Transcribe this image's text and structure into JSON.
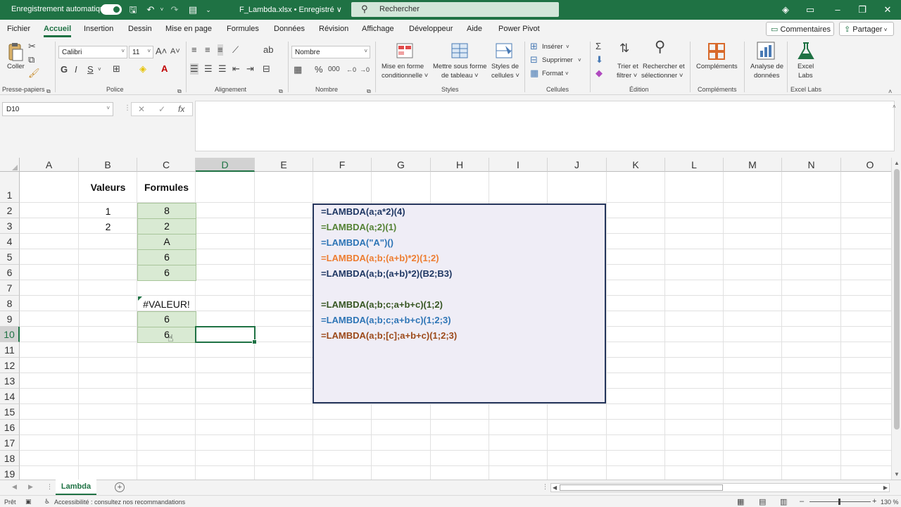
{
  "titlebar": {
    "autosave_label": "Enregistrement automatique",
    "file_title": "F_Lambda.xlsx • Enregistré ∨",
    "search_placeholder": "Rechercher",
    "accent_color": "#1f7244"
  },
  "menu": {
    "tabs": [
      "Fichier",
      "Accueil",
      "Insertion",
      "Dessin",
      "Mise en page",
      "Formules",
      "Données",
      "Révision",
      "Affichage",
      "Développeur",
      "Aide",
      "Power Pivot"
    ],
    "active_tab": "Accueil",
    "comments_label": "Commentaires",
    "share_label": "Partager"
  },
  "ribbon": {
    "clipboard": {
      "paste_label": "Coller",
      "group_label": "Presse-papiers"
    },
    "font": {
      "font_name": "Calibri",
      "font_size": "11",
      "bold": "G",
      "italic": "I",
      "underline": "S",
      "group_label": "Police"
    },
    "alignment": {
      "group_label": "Alignement"
    },
    "number": {
      "format": "Nombre",
      "group_label": "Nombre"
    },
    "styles": {
      "conditional_line1": "Mise en forme",
      "conditional_line2": "conditionnelle ˅",
      "table_line1": "Mettre sous forme",
      "table_line2": "de tableau ˅",
      "cellstyles_line1": "Styles de",
      "cellstyles_line2": "cellules ˅",
      "group_label": "Styles"
    },
    "cells": {
      "insert": "Insérer",
      "delete": "Supprimer",
      "format": "Format",
      "group_label": "Cellules"
    },
    "editing": {
      "sort_line1": "Trier et",
      "sort_line2": "filtrer ˅",
      "find_line1": "Rechercher et",
      "find_line2": "sélectionner ˅",
      "group_label": "Édition"
    },
    "addins": {
      "label": "Compléments",
      "group_label": "Compléments"
    },
    "analysis": {
      "line1": "Analyse de",
      "line2": "données"
    },
    "labs": {
      "line1": "Excel",
      "line2": "Labs",
      "group_label": "Excel Labs"
    }
  },
  "formula_bar": {
    "name_box": "D10",
    "cancel": "✕",
    "enter": "✓",
    "fx": "fx",
    "content": ""
  },
  "grid": {
    "columns": [
      "A",
      "B",
      "C",
      "D",
      "E",
      "F",
      "G",
      "H",
      "I",
      "J",
      "K",
      "L",
      "M",
      "N",
      "O"
    ],
    "selected_column": "D",
    "rows": [
      "1",
      "2",
      "3",
      "4",
      "5",
      "6",
      "7",
      "8",
      "9",
      "10",
      "11",
      "12",
      "13",
      "14",
      "15",
      "16",
      "17",
      "18",
      "19"
    ],
    "selected_row": "10",
    "headers": {
      "valeurs": "Valeurs",
      "formules": "Formules"
    },
    "valeurs": [
      "1",
      "2"
    ],
    "formules_top": [
      "8",
      "2",
      "A",
      "6",
      "6"
    ],
    "error_value": "#VALEUR!",
    "formules_bottom": [
      "6",
      "6"
    ]
  },
  "lambda_box": {
    "border_color": "#25365c",
    "lines": [
      {
        "text": "=LAMBDA(a;a*2)(4)",
        "color": "#203864"
      },
      {
        "text": "=LAMBDA(a;2)(1)",
        "color": "#548235"
      },
      {
        "text": "=LAMBDA(\"A\")()",
        "color": "#2e75b6"
      },
      {
        "text": "=LAMBDA(a;b;(a+b)*2)(1;2)",
        "color": "#ed7d31"
      },
      {
        "text": "=LAMBDA(a;b;(a+b)*2)(B2;B3)",
        "color": "#203864"
      },
      {
        "text": "=LAMBDA(a;b;c;a+b+c)(1;2)",
        "color": "#375623"
      },
      {
        "text": "=LAMBDA(a;b;c;a+b+c)(1;2;3)",
        "color": "#2e75b6"
      },
      {
        "text": "=LAMBDA(a;b;[c];a+b+c)(1;2;3)",
        "color": "#9c4a1a"
      }
    ]
  },
  "sheets": {
    "active": "Lambda"
  },
  "status": {
    "ready": "Prêt",
    "accessibility": "Accessibilité : consultez nos recommandations",
    "zoom": "130 %"
  }
}
